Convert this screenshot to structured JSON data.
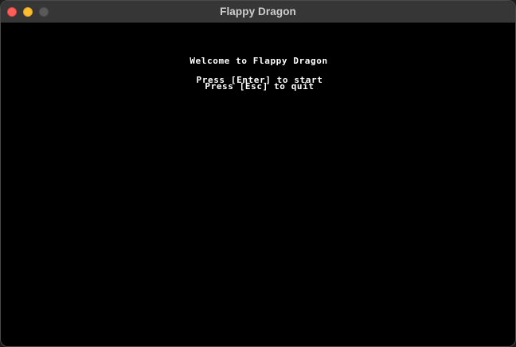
{
  "window": {
    "title": "Flappy Dragon"
  },
  "screen": {
    "welcome": "Welcome to Flappy Dragon",
    "start_hint": "Press [Enter] to start",
    "quit_hint": "Press [Esc] to quit"
  }
}
